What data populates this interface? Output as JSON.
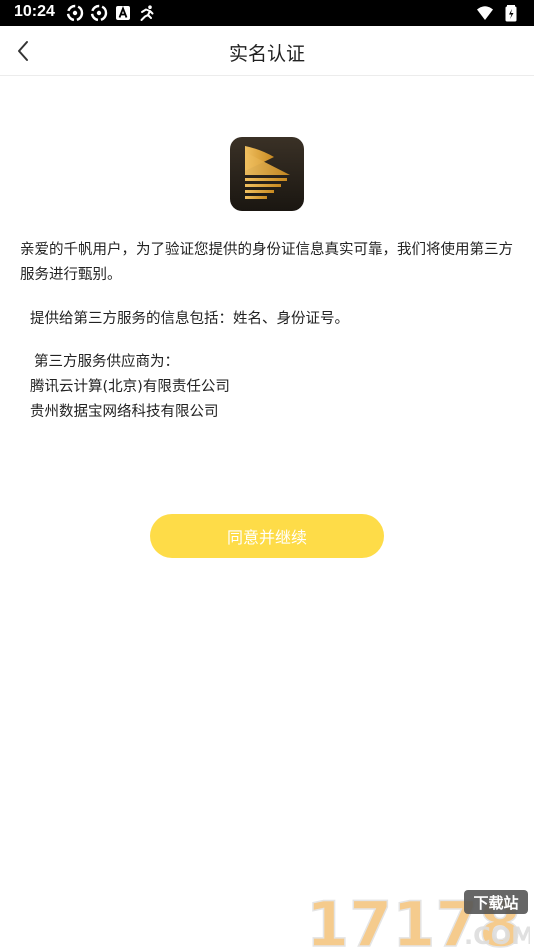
{
  "status_bar": {
    "time": "10:24",
    "icons": [
      "sync-icon",
      "sync-icon",
      "font-icon",
      "running-icon",
      "wifi-icon",
      "battery-icon"
    ]
  },
  "header": {
    "title": "实名认证",
    "back_icon": "chevron-left-icon"
  },
  "content": {
    "intro": "亲爱的千帆用户，为了验证您提供的身份证信息真实可靠，我们将使用第三方服务进行甄别。",
    "info": "提供给第三方服务的信息包括：姓名、身份证号。",
    "providers_title": "第三方服务供应商为：",
    "providers": [
      "腾讯云计算(北京)有限责任公司",
      "贵州数据宝网络科技有限公司"
    ]
  },
  "actions": {
    "agree_label": "同意并继续"
  },
  "watermark": {
    "number": "17178",
    "tag": "下载站",
    "domain": ".COM"
  },
  "colors": {
    "accent": "#fedc48",
    "logo_bg": "#2a241c",
    "logo_gold": "#e0a838"
  }
}
